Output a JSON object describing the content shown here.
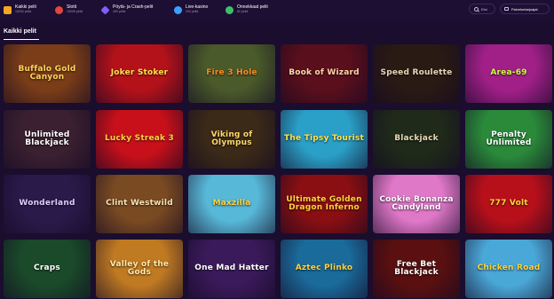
{
  "categories": [
    {
      "name": "Kaikki pelit",
      "count": "16254 peliä",
      "icon": "crown-icon",
      "color": "#f5a623"
    },
    {
      "name": "Slotit",
      "count": "15905 peliä",
      "icon": "slots-icon",
      "color": "#e0463d"
    },
    {
      "name": "Pöytä- ja Crash-pelit",
      "count": "490 peliä",
      "icon": "diamond-icon",
      "color": "#7b61ff"
    },
    {
      "name": "Live-kasino",
      "count": "334 peliä",
      "icon": "chip-icon",
      "color": "#3aa0ff"
    },
    {
      "name": "Onnekkaat pelit",
      "count": "80 peliä",
      "icon": "clover-icon",
      "color": "#3fbf6a"
    }
  ],
  "search": {
    "label": "Etsi",
    "icon": "search-icon"
  },
  "providers": {
    "label": "Palveluntarjoajat",
    "icon": "providers-icon"
  },
  "section_tab": "Kaikki pelit",
  "games": [
    {
      "title": "Buffalo Gold Canyon",
      "bg": "#7a3d18",
      "fg": "#ffd35c"
    },
    {
      "title": "Joker Stoker",
      "bg": "#b3121a",
      "fg": "#ffe14a"
    },
    {
      "title": "Fire 3 Hole",
      "bg": "#4a5a2a",
      "fg": "#ff8a1e"
    },
    {
      "title": "Book of Wizard",
      "bg": "#5a0f1c",
      "fg": "#ffd7a8"
    },
    {
      "title": "Speed Roulette",
      "bg": "#2a1a14",
      "fg": "#e8d7b5"
    },
    {
      "title": "Area-69",
      "bg": "#a02088",
      "fg": "#c9ff3a"
    },
    {
      "title": "Unlimited Blackjack",
      "bg": "#3a2030",
      "fg": "#ffffff"
    },
    {
      "title": "Lucky Streak 3",
      "bg": "#c8101a",
      "fg": "#ffd23a"
    },
    {
      "title": "Viking of Olympus",
      "bg": "#3b2a18",
      "fg": "#ffd86b"
    },
    {
      "title": "The Tipsy Tourist",
      "bg": "#2aa0c8",
      "fg": "#ffe24a"
    },
    {
      "title": "Blackjack",
      "bg": "#1f2a1a",
      "fg": "#e8d7b5"
    },
    {
      "title": "Penalty Unlimited",
      "bg": "#2a8a3a",
      "fg": "#ffffff"
    },
    {
      "title": "Wonderland",
      "bg": "#2a1a4a",
      "fg": "#e0c8ff"
    },
    {
      "title": "Clint Westwild",
      "bg": "#7a4a22",
      "fg": "#f5e1b5"
    },
    {
      "title": "Maxzilla",
      "bg": "#58b8d8",
      "fg": "#ffd23a"
    },
    {
      "title": "Ultimate Golden Dragon Inferno",
      "bg": "#8a0f12",
      "fg": "#ffd23a"
    },
    {
      "title": "Cookie Bonanza Candyland",
      "bg": "#e078c8",
      "fg": "#ffffff"
    },
    {
      "title": "777 Volt",
      "bg": "#b8101a",
      "fg": "#ffd23a"
    },
    {
      "title": "Craps",
      "bg": "#1a4a2a",
      "fg": "#ffffff"
    },
    {
      "title": "Valley of the Gods",
      "bg": "#c07a22",
      "fg": "#ffe9a8"
    },
    {
      "title": "One Mad Hatter",
      "bg": "#3a1a5a",
      "fg": "#ffffff"
    },
    {
      "title": "Aztec Plinko",
      "bg": "#1a6a9a",
      "fg": "#ffd23a"
    },
    {
      "title": "Free Bet Blackjack",
      "bg": "#5a1010",
      "fg": "#ffffff"
    },
    {
      "title": "Chicken Road",
      "bg": "#4aa8d8",
      "fg": "#ffd23a"
    }
  ]
}
